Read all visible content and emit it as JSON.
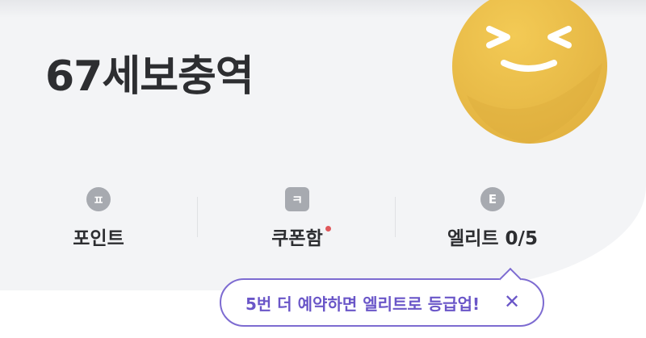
{
  "header": {
    "title": "67세보충역"
  },
  "mascot": {
    "icon": "smiling-face-icon",
    "color": "#ecbf4a"
  },
  "stats": [
    {
      "badge": "ㅍ",
      "label": "포인트",
      "badge_shape": "circle"
    },
    {
      "badge": "ㅋ",
      "label": "쿠폰함",
      "badge_shape": "square",
      "new_indicator": true
    },
    {
      "badge": "E",
      "label": "엘리트 0/5",
      "badge_shape": "circle"
    }
  ],
  "tooltip": {
    "text": "5번 더 예약하면 엘리트로 등급업!",
    "close_icon": "close-icon",
    "accent_color": "#6a56c8"
  },
  "colors": {
    "indicator": "#e0585b",
    "badge": "#a7aab0",
    "background": "#f3f4f6"
  }
}
